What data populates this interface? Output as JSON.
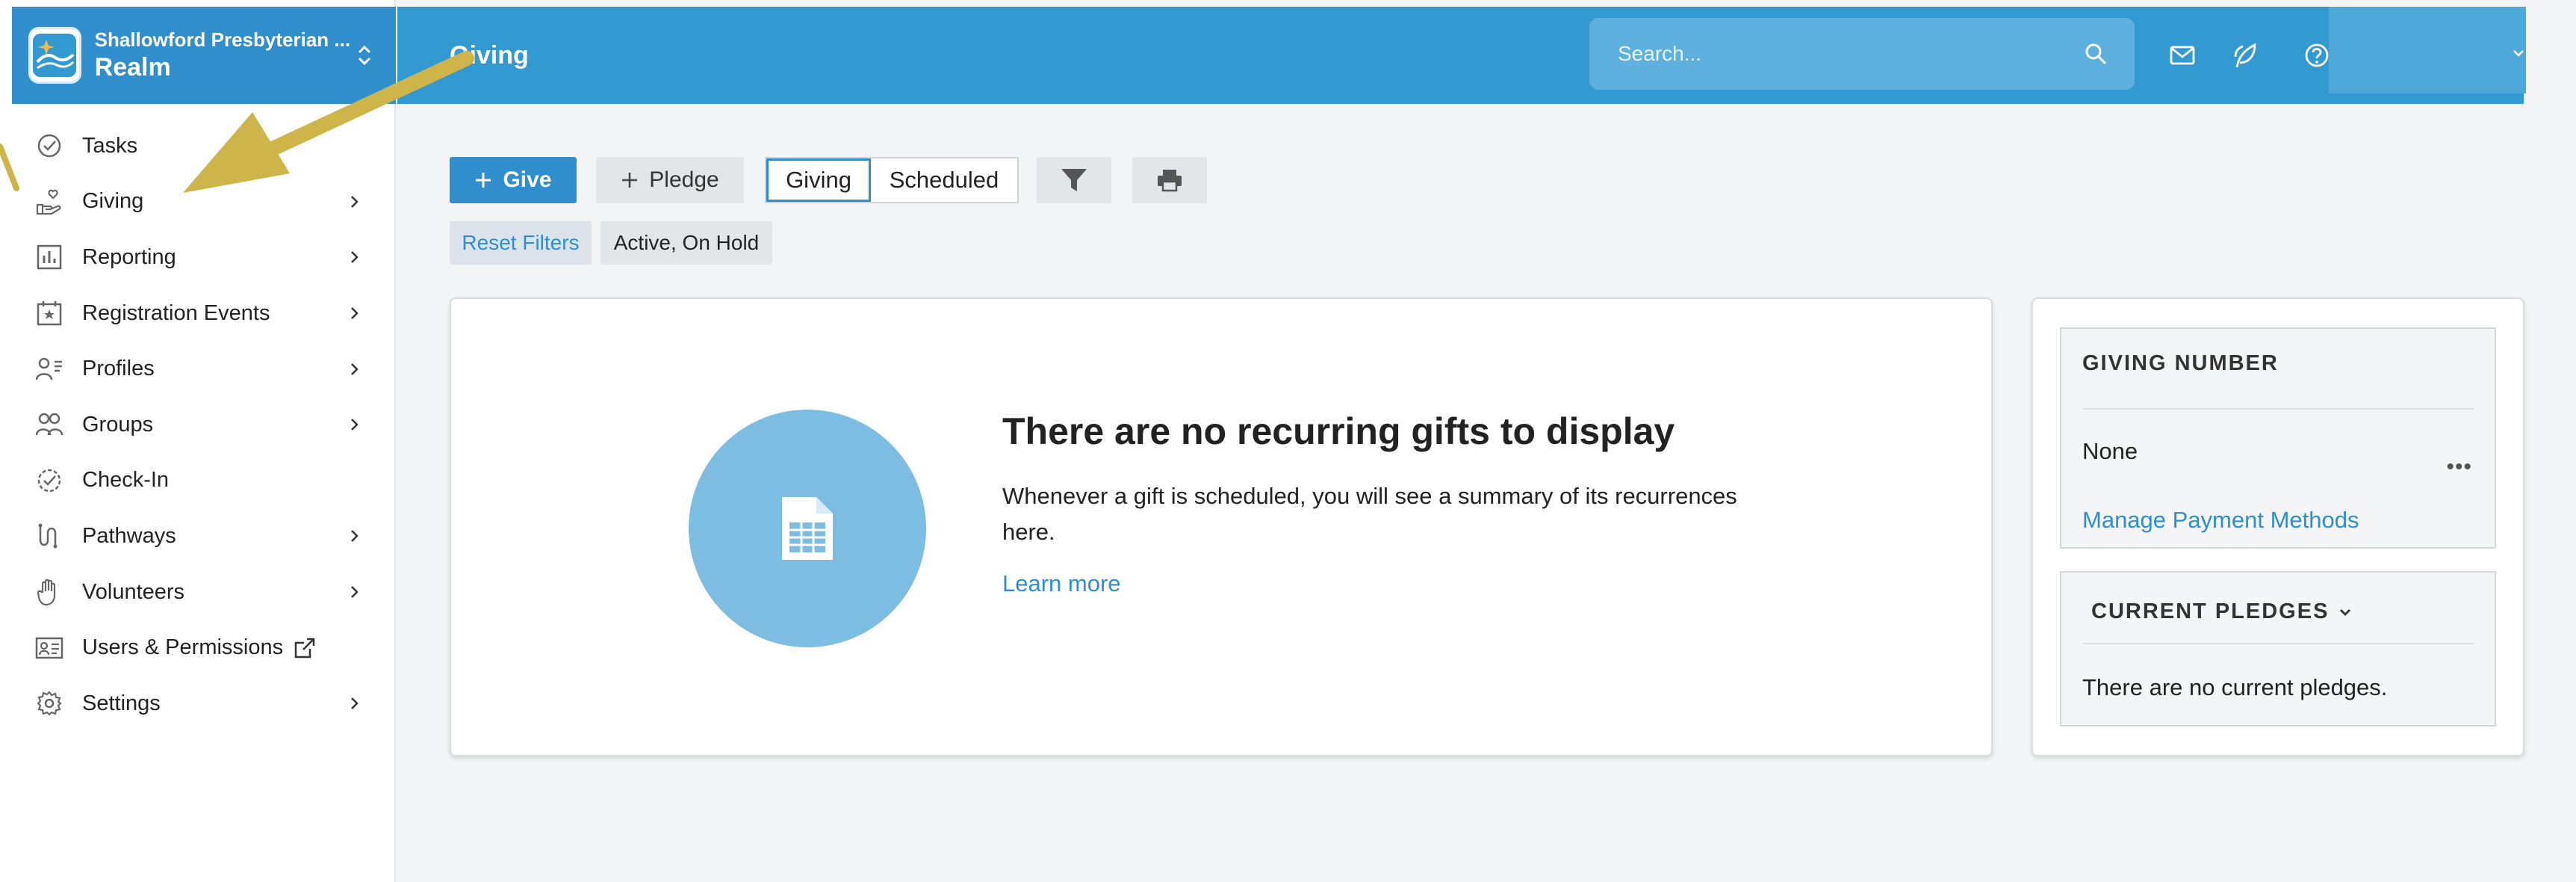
{
  "org": {
    "name": "Shallowford Presbyterian ...",
    "product": "Realm"
  },
  "header": {
    "title": "Giving",
    "search_placeholder": "Search..."
  },
  "sidebar": {
    "items": [
      {
        "label": "Tasks",
        "icon": "check-circle-icon",
        "chevron": false
      },
      {
        "label": "Giving",
        "icon": "hand-heart-icon",
        "chevron": true
      },
      {
        "label": "Reporting",
        "icon": "bar-chart-icon",
        "chevron": true
      },
      {
        "label": "Registration Events",
        "icon": "calendar-star-icon",
        "chevron": true
      },
      {
        "label": "Profiles",
        "icon": "person-list-icon",
        "chevron": true
      },
      {
        "label": "Groups",
        "icon": "people-icon",
        "chevron": true
      },
      {
        "label": "Check-In",
        "icon": "badge-check-icon",
        "chevron": false
      },
      {
        "label": "Pathways",
        "icon": "path-icon",
        "chevron": true
      },
      {
        "label": "Volunteers",
        "icon": "raised-hand-icon",
        "chevron": true
      },
      {
        "label": "Users & Permissions",
        "icon": "id-card-icon",
        "chevron": false
      },
      {
        "label": "Settings",
        "icon": "gear-icon",
        "chevron": true
      }
    ]
  },
  "toolbar": {
    "give_label": "Give",
    "pledge_label": "Pledge",
    "tab_giving": "Giving",
    "tab_scheduled": "Scheduled"
  },
  "filters": {
    "reset_label": "Reset Filters",
    "active_label": "Active, On Hold"
  },
  "empty_state": {
    "title": "There are no recurring gifts to display",
    "description": "Whenever a gift is scheduled, you will see a summary of its recurrences here.",
    "link": "Learn more"
  },
  "giving_number": {
    "heading": "GIVING NUMBER",
    "value": "None",
    "more": "•••",
    "link": "Manage Payment Methods"
  },
  "pledges": {
    "heading": "CURRENT PLEDGES",
    "empty": "There are no current pledges."
  },
  "colors": {
    "brand": "#2f8ecb",
    "topbar": "#3399d1",
    "annotation_arrow": "#cdb54a"
  }
}
